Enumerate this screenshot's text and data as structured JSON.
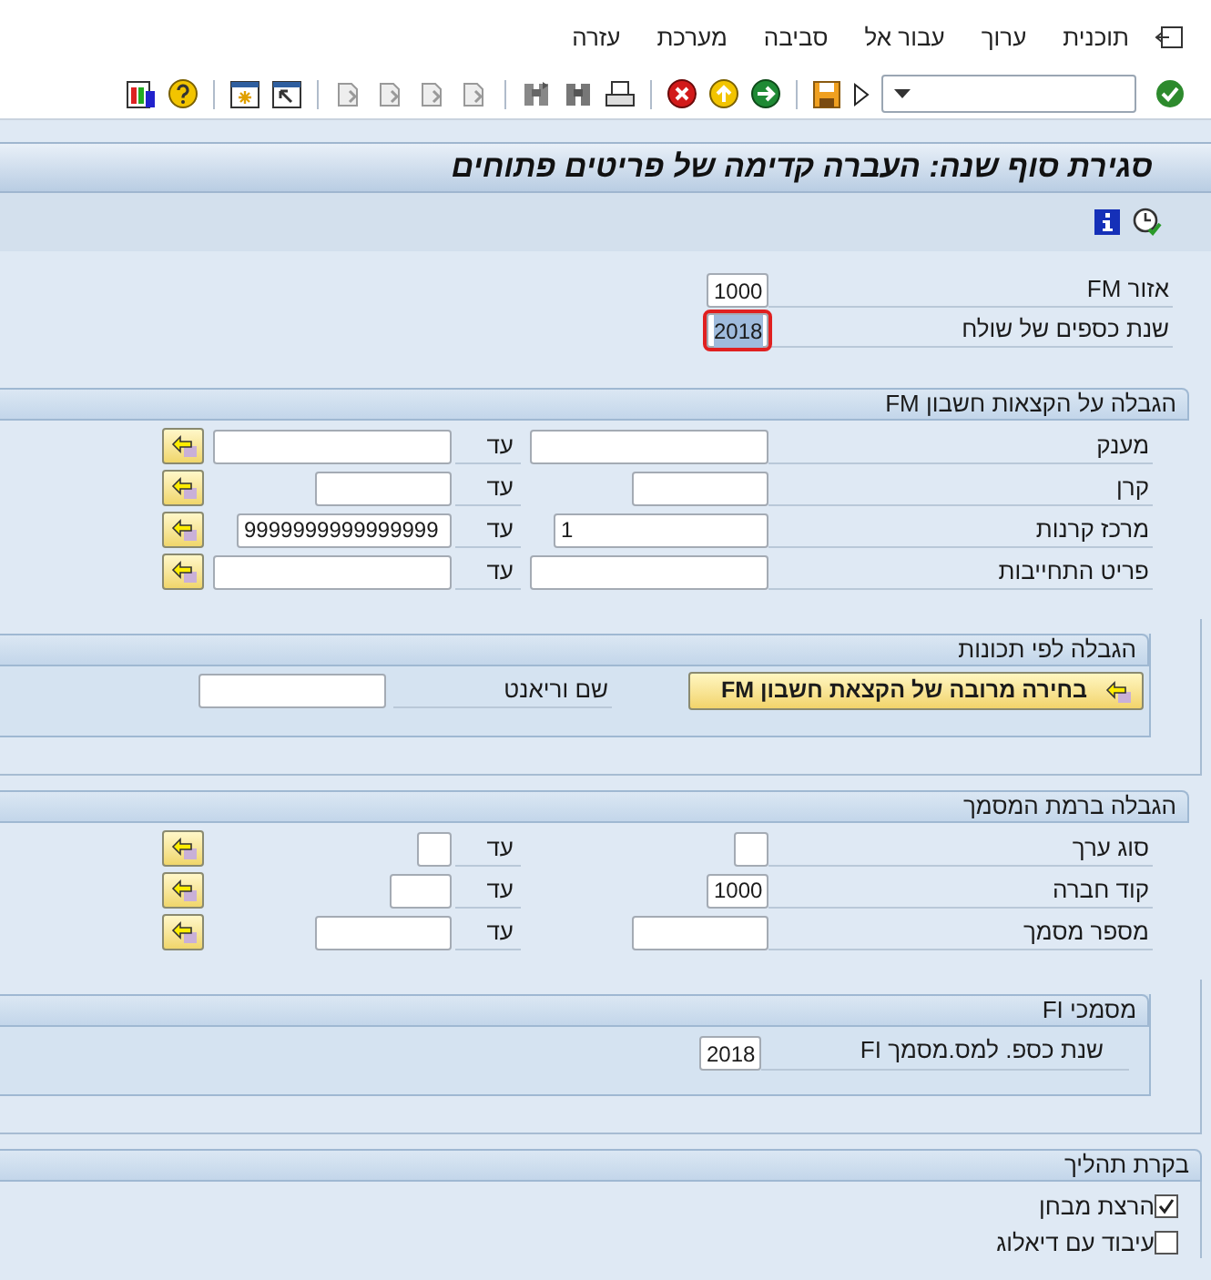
{
  "menu": [
    {
      "label": "תוכנית"
    },
    {
      "label": "ערוך"
    },
    {
      "label": "עבור אל"
    },
    {
      "label": "סביבה"
    },
    {
      "label": "מערכת"
    },
    {
      "label": "עזרה"
    }
  ],
  "title": "סגירת סוף שנה: העברה קדימה של פריטים פתוחים",
  "header_fields": [
    {
      "label": "אזור FM",
      "value": "1000",
      "focused": false
    },
    {
      "label": "שנת כספים של שולח",
      "value": "2018",
      "focused": true
    }
  ],
  "sections": [
    {
      "kind": "ranges",
      "title": "הגבלה על הקצאות חשבון FM",
      "rows": [
        {
          "label": "מענק",
          "to_label": "עד"
        },
        {
          "label": "קרן",
          "to_label": "עד"
        },
        {
          "label": "מרכז קרנות",
          "from": "1",
          "to_label": "עד",
          "to": "9999999999999999"
        },
        {
          "label": "פריט התחייבות",
          "to_label": "עד"
        }
      ]
    },
    {
      "kind": "selection",
      "title": "הגבלה לפי תכונות",
      "button": "בחירה מרובה של הקצאת חשבון FM",
      "field_label": "שם וריאנט"
    },
    {
      "kind": "ranges",
      "title": "הגבלה ברמת המסמך",
      "rows": [
        {
          "label": "סוג ערך",
          "to_label": "עד"
        },
        {
          "label": "קוד חברה",
          "from": "1000",
          "to_label": "עד"
        },
        {
          "label": "מספר מסמך",
          "to_label": "עד"
        }
      ]
    },
    {
      "kind": "single",
      "title": "מסמכי FI",
      "field_label": "שנת כספ. למס.מסמך FI",
      "value": "2018"
    },
    {
      "kind": "checkboxes",
      "title": "בקרת תהליך",
      "items": [
        {
          "label": "הרצת מבחן",
          "checked": true
        },
        {
          "label": "עיבוד עם דיאלוג",
          "checked": false
        }
      ]
    }
  ]
}
